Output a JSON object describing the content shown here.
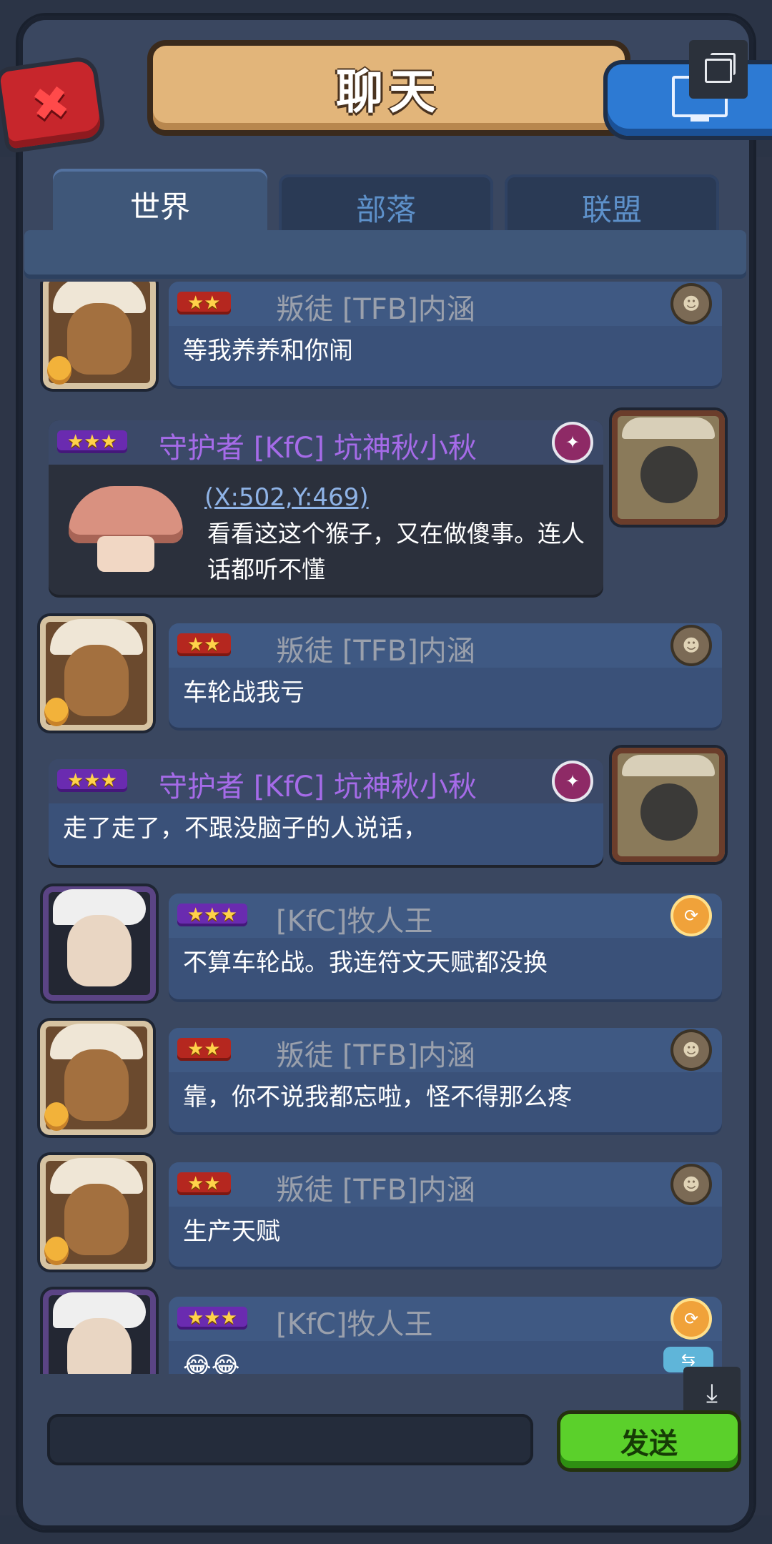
{
  "window": {
    "title": "聊天",
    "close_icon": "close-icon",
    "window_icon": "monitor-icon"
  },
  "tabs": [
    {
      "label": "世界",
      "active": true
    },
    {
      "label": "部落",
      "active": false
    },
    {
      "label": "联盟",
      "active": false
    }
  ],
  "messages": [
    {
      "side": "left",
      "stars": "★★",
      "name": "叛徒 [TFB]内涵",
      "text": "等我养养和你闹",
      "avatar": "rabbit-hat-avatar",
      "badge": "orc-badge-icon"
    },
    {
      "side": "right",
      "stars": "★★★",
      "name": "守护者 [KfC] 坑神秋小秋",
      "coords": "(X:502,Y:469)",
      "text": "看看这这个猴子，又在做傻事。连人话都听不懂",
      "avatar": "bull-avatar",
      "badge": "shield-badge-icon"
    },
    {
      "side": "left",
      "stars": "★★",
      "name": "叛徒 [TFB]内涵",
      "text": "车轮战我亏",
      "avatar": "rabbit-hat-avatar",
      "badge": "orc-badge-icon"
    },
    {
      "side": "right",
      "stars": "★★★",
      "name": "守护者 [KfC] 坑神秋小秋",
      "text": "走了走了，不跟没脑子的人说话，",
      "avatar": "bull-avatar",
      "badge": "shield-badge-icon"
    },
    {
      "side": "left",
      "stars": "★★★",
      "name": "[KfC]牧人王",
      "text": "不算车轮战。我连符文天赋都没换",
      "avatar": "white-hair-avatar",
      "badge": "gold-badge-icon"
    },
    {
      "side": "left",
      "stars": "★★",
      "name": "叛徒 [TFB]内涵",
      "text": "靠，你不说我都忘啦，怪不得那么疼",
      "avatar": "rabbit-hat-avatar",
      "badge": "orc-badge-icon"
    },
    {
      "side": "left",
      "stars": "★★",
      "name": "叛徒 [TFB]内涵",
      "text": "生产天赋",
      "avatar": "rabbit-hat-avatar",
      "badge": "orc-badge-icon"
    },
    {
      "side": "left",
      "stars": "★★★",
      "name": "[KfC]牧人王",
      "text": "😂😂",
      "avatar": "white-hair-avatar",
      "badge": "gold-badge-icon"
    }
  ],
  "footer": {
    "input_placeholder": "",
    "send_label": "发送",
    "download_icon": "download-icon",
    "transfer_icon": "transfer-icon"
  }
}
